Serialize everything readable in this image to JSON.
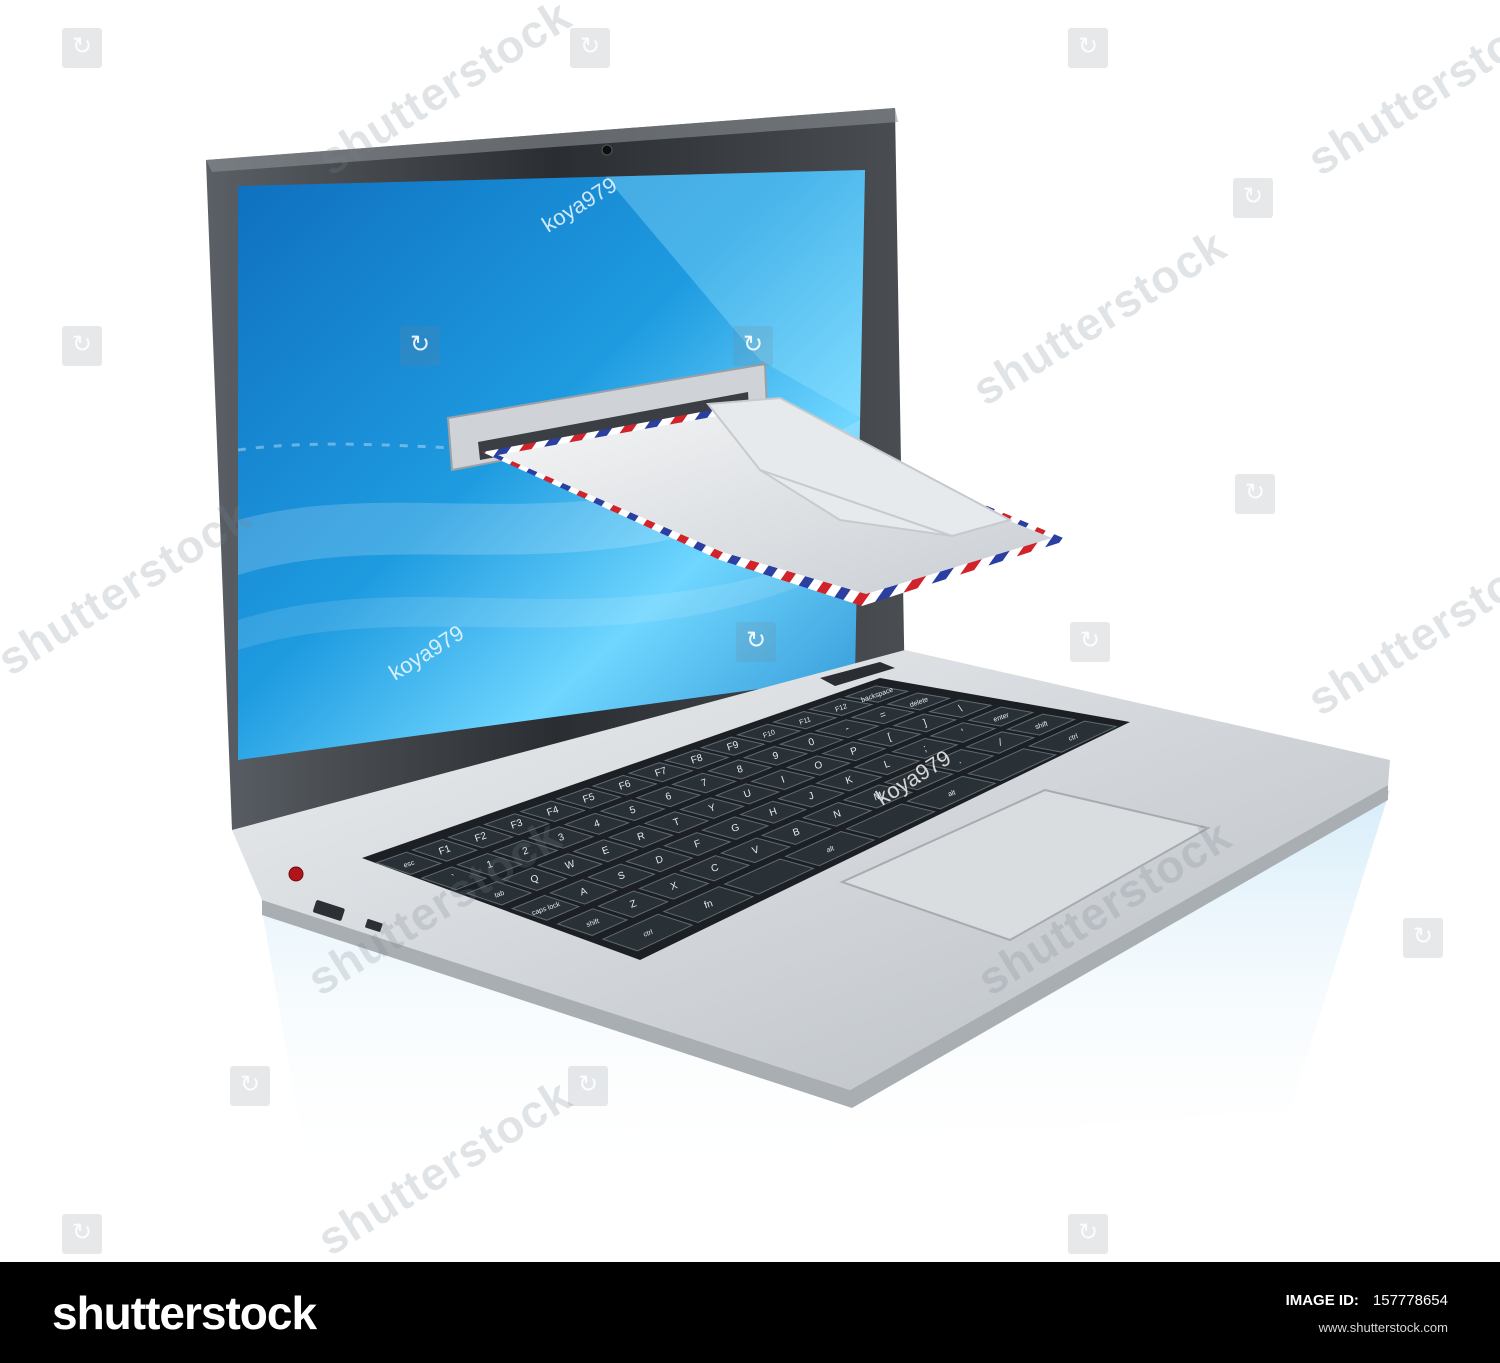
{
  "photo": {
    "screen_watermarks": [
      "koya979",
      "koya979",
      "koya979"
    ],
    "watermark_text": "shutterstock",
    "colors": {
      "screen": "#1e9be0",
      "screen_light": "#6fd6ff",
      "chassis": "#d2d6da",
      "key": "#1f2529",
      "airmail_red": "#d1232b",
      "airmail_blue": "#2a3fa0"
    }
  },
  "keyboard": {
    "rows": [
      [
        "esc",
        "F1",
        "F2",
        "F3",
        "F4",
        "F5",
        "F6",
        "F7",
        "F8",
        "F9",
        "F10",
        "F11",
        "F12",
        "backspace"
      ],
      [
        "`",
        "1",
        "2",
        "3",
        "4",
        "5",
        "6",
        "7",
        "8",
        "9",
        "0",
        "-",
        "=",
        "delete"
      ],
      [
        "tab",
        "Q",
        "W",
        "E",
        "R",
        "T",
        "Y",
        "U",
        "I",
        "O",
        "P",
        "[",
        "]",
        "\\"
      ],
      [
        "caps lock",
        "A",
        "S",
        "D",
        "F",
        "G",
        "H",
        "J",
        "K",
        "L",
        ";",
        "'",
        "enter"
      ],
      [
        "shift",
        "Z",
        "X",
        "C",
        "V",
        "B",
        "N",
        "M",
        ",",
        ".",
        "/",
        "shift"
      ],
      [
        "ctrl",
        "fn",
        "",
        "alt",
        "",
        "alt",
        "",
        "ctrl"
      ]
    ]
  },
  "footer": {
    "brand": "shutterstock",
    "image_id_label": "IMAGE ID:",
    "image_id": "157778654",
    "site": "www.shutterstock.com"
  }
}
